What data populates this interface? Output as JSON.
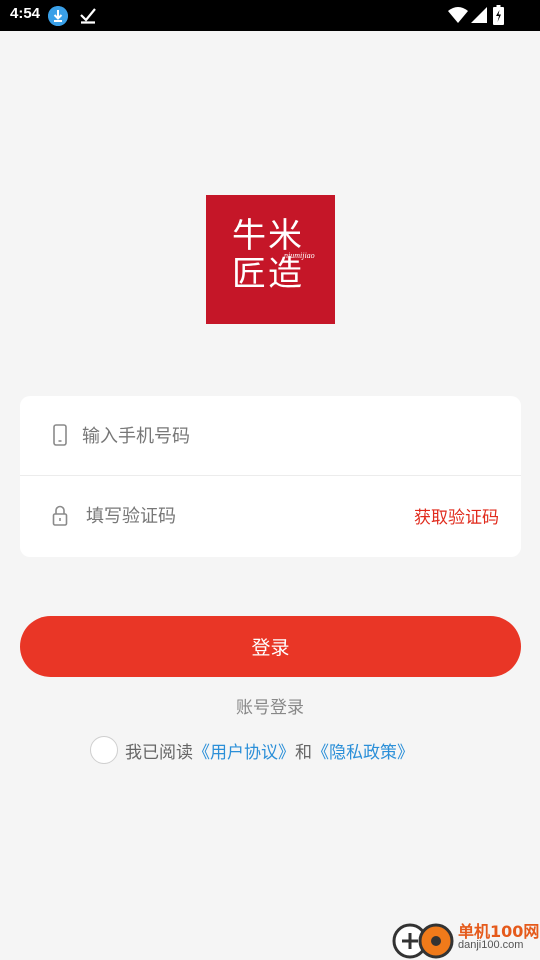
{
  "status_bar": {
    "time": "4:54",
    "download_icon": "download-icon",
    "check_icon": "check-icon",
    "wifi_icon": "wifi-icon",
    "signal_icon": "signal-icon",
    "battery_icon": "battery-icon"
  },
  "logo": {
    "line1": "牛米",
    "line2": "匠造",
    "sub": "niumijiao"
  },
  "form": {
    "phone_placeholder": "输入手机号码",
    "phone_icon": "phone-icon",
    "code_placeholder": "填写验证码",
    "lock_icon": "lock-icon",
    "get_code_label": "获取验证码"
  },
  "login_button_label": "登录",
  "account_login_label": "账号登录",
  "agreement": {
    "prefix": "我已阅读",
    "user_agreement": "《用户协议》",
    "and": "和",
    "privacy_policy": "《隐私政策》"
  },
  "watermark": {
    "title": "单机100网",
    "url": "danji100.com"
  },
  "colors": {
    "brand_red": "#c51628",
    "button_red": "#e93626",
    "link_blue": "#2b8fd8"
  }
}
